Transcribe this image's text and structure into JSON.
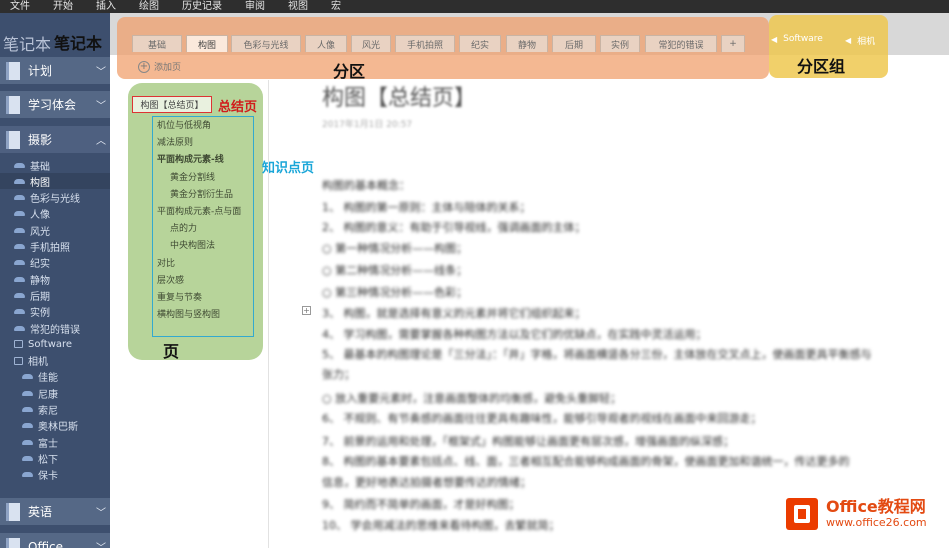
{
  "menubar": [
    "文件",
    "开始",
    "插入",
    "绘图",
    "历史记录",
    "审阅",
    "视图",
    "宏"
  ],
  "sidebar": {
    "title": "笔记本",
    "notebooks_top": [
      {
        "label": "计划"
      },
      {
        "label": "学习体会"
      },
      {
        "label": "摄影"
      }
    ],
    "sections": [
      "基础",
      "构图",
      "色彩与光线",
      "人像",
      "风光",
      "手机拍照",
      "纪实",
      "静物",
      "后期",
      "实例",
      "常犯的错误"
    ],
    "section_group": "Software",
    "sub_group": "相机",
    "sub_sections": [
      "佳能",
      "尼康",
      "索尼",
      "奥林巴斯",
      "富士",
      "松下",
      "保卡"
    ],
    "notebooks_bottom": [
      {
        "label": "英语"
      },
      {
        "label": "Office"
      }
    ]
  },
  "tabs": {
    "sections": [
      "基础",
      "构图",
      "色彩与光线",
      "人像",
      "风光",
      "手机拍照",
      "纪实",
      "静物",
      "后期",
      "实例",
      "常犯的错误"
    ],
    "active": "构图",
    "add_tab": "+",
    "section_groups": [
      "Software",
      "相机"
    ]
  },
  "annotations": {
    "notebook": "笔记本",
    "section": "分区",
    "section_group": "分区组",
    "summary_page": "总结页",
    "knowledge_point": "知识点页",
    "page": "页"
  },
  "pages": {
    "add_page": "添加页",
    "summary": "构图【总结页】",
    "items": [
      {
        "label": "机位与低视角",
        "level": 1,
        "bold": false
      },
      {
        "label": "减法原则",
        "level": 1,
        "bold": false
      },
      {
        "label": "平面构成元素-线",
        "level": 1,
        "bold": true
      },
      {
        "label": "黄金分割线",
        "level": 2,
        "bold": false
      },
      {
        "label": "黄金分割衍生品",
        "level": 2,
        "bold": false
      },
      {
        "label": "平面构成元素-点与面",
        "level": 1,
        "bold": false
      },
      {
        "label": "点的力",
        "level": 2,
        "bold": false
      },
      {
        "label": "中央构图法",
        "level": 2,
        "bold": false
      },
      {
        "label": "对比",
        "level": 1,
        "bold": false
      },
      {
        "label": "层次感",
        "level": 1,
        "bold": false
      },
      {
        "label": "重复与节奏",
        "level": 1,
        "bold": false
      },
      {
        "label": "横构图与竖构图",
        "level": 1,
        "bold": false
      }
    ]
  },
  "note": {
    "title": "构图【总结页】",
    "date": "2017年1月1日  20:57",
    "lines": [
      "构图的基本概念：",
      "1、   构图的第一原则：主体与陪体的关系；",
      "2、   构图的意义：有助于引导视线，强调画面的主体；",
      "      ○  第一种情况分析——构图；",
      "      ○  第二种情况分析——线条；",
      "      ○  第三种情况分析——色彩；",
      "3、   构图，就是选择有意义的元素并将它们组织起来；",
      "4、   学习构图，需要掌握各种构图方法以及它们的优缺点，在实践中灵活运用；",
      "5、   最基本的构图理论是「三分法」：「井」字格，将画面横竖各分三份，主体放在交叉点上，使画面更具平衡感与",
      "      张力；",
      "      ○  放入重要元素时，注意画面整体的均衡感，避免头重脚轻；",
      "6、   不规则、有节奏感的画面往往更具有趣味性，能够引导观者的视线在画面中来回游走；",
      "7、   前景的运用和处理，「框架式」构图能够让画面更有层次感，增强画面的纵深感；",
      "8、   构图的基本要素包括点、线、面，三者相互配合能够构成画面的骨架，使画面更加和谐统一，传达更多的",
      "      信息，更好地表达拍摄者想要传达的情绪；",
      "9、   简约而不简单的画面，才是好构图；",
      "10、  学会用减法的思维来看待构图，去繁就简；"
    ]
  },
  "logo": {
    "line1": "Office教程网",
    "line2": "www.office26.com"
  }
}
